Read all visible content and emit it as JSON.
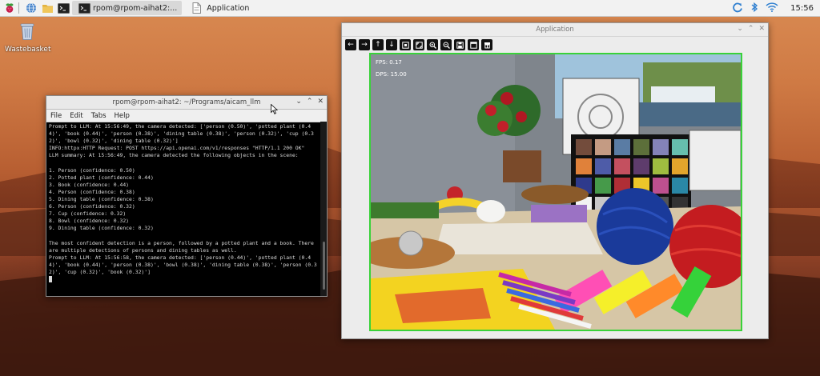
{
  "taskbar": {
    "tasks": [
      {
        "label": "rpom@rpom-aihat2:...",
        "icon": "terminal-icon",
        "active": true
      },
      {
        "label": "Application",
        "icon": "document-icon",
        "active": false
      }
    ],
    "launchers": [
      "raspberry-menu-icon",
      "browser-icon",
      "file-manager-icon",
      "terminal-icon"
    ],
    "tray": [
      "refresh-icon",
      "bluetooth-icon",
      "wifi-icon"
    ],
    "clock": "15:56"
  },
  "desktop": {
    "icons": [
      {
        "label": "Wastebasket",
        "icon": "trash-icon"
      }
    ]
  },
  "terminal": {
    "title": "rpom@rpom-aihat2: ~/Programs/aicam_llm",
    "menu": [
      "File",
      "Edit",
      "Tabs",
      "Help"
    ],
    "lines": [
      "Prompt to LLM: At 15:56:49, the camera detected: ['person (0.50)', 'potted plant (0.44)', 'book (0.44)', 'person (0.38)', 'dining table (0.38)', 'person (0.32)', 'cup (0.32)', 'bowl (0.32)', 'dining table (0.32)']",
      "INFO:httpx:HTTP Request: POST https://api.openai.com/v1/responses \"HTTP/1.1 200 OK\"",
      "LLM summary: At 15:56:49, the camera detected the following objects in the scene:",
      "",
      "1. Person (confidence: 0.50)",
      "2. Potted plant (confidence: 0.44)",
      "3. Book (confidence: 0.44)",
      "4. Person (confidence: 0.38)",
      "5. Dining table (confidence: 0.38)",
      "6. Person (confidence: 0.32)",
      "7. Cup (confidence: 0.32)",
      "8. Bowl (confidence: 0.32)",
      "9. Dining table (confidence: 0.32)",
      "",
      "The most confident detection is a person, followed by a potted plant and a book. There are multiple detections of persons and dining tables as well.",
      "Prompt to LLM: At 15:56:58, the camera detected: ['person (0.44)', 'potted plant (0.44)', 'book (0.44)', 'person (0.38)', 'bowl (0.38)', 'dining table (0.38)', 'person (0.32)', 'cup (0.32)', 'book (0.32)']"
    ]
  },
  "app": {
    "title": "Application",
    "toolbar": [
      "arrow-left-icon",
      "arrow-right-icon",
      "arrow-up-icon",
      "arrow-down-icon",
      "zoom-box-icon",
      "zoom-fit-icon",
      "zoom-in-icon",
      "zoom-out-icon",
      "save-icon",
      "copy-icon",
      "properties-icon"
    ],
    "overlay": {
      "fps": "FPS: 0.17",
      "dps": "DPS: 15.00"
    },
    "frame_border_color": "#39d23a"
  }
}
